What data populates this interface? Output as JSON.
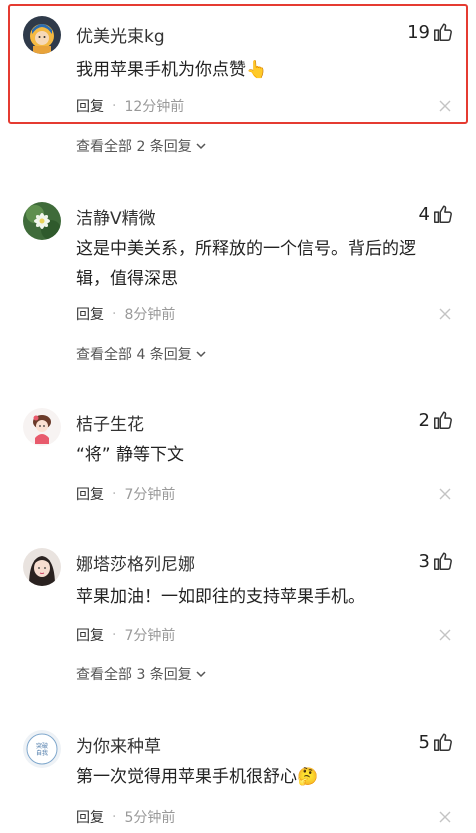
{
  "comments": [
    {
      "name": "优美光束kg",
      "likes": "19",
      "text": "我用苹果手机为你点赞👆",
      "reply_label": "回复",
      "time": "12分钟前",
      "view_all": "查看全部 2 条回复"
    },
    {
      "name": "洁静V精微",
      "likes": "4",
      "text": "这是中美关系，所释放的一个信号。背后的逻辑，值得深思",
      "reply_label": "回复",
      "time": "8分钟前",
      "view_all": "查看全部 4 条回复"
    },
    {
      "name": "桔子生花",
      "likes": "2",
      "text": "“将” 静等下文",
      "reply_label": "回复",
      "time": "7分钟前"
    },
    {
      "name": "娜塔莎格列尼娜",
      "likes": "3",
      "text": "苹果加油！一如即往的支持苹果手机。",
      "reply_label": "回复",
      "time": "7分钟前",
      "view_all": "查看全部 3 条回复"
    },
    {
      "name": "为你来种草",
      "likes": "5",
      "text": "第一次觉得用苹果手机很舒心🤔",
      "reply_label": "回复",
      "time": "5分钟前"
    }
  ],
  "separator": "·",
  "avatar5_text": "突破 自我",
  "colors": {
    "highlight": "#e53b31",
    "meta": "#999999",
    "text": "#222222"
  },
  "icons": {
    "like": "thumbs-up-icon",
    "close": "close-icon",
    "expand": "chevron-down-icon"
  }
}
